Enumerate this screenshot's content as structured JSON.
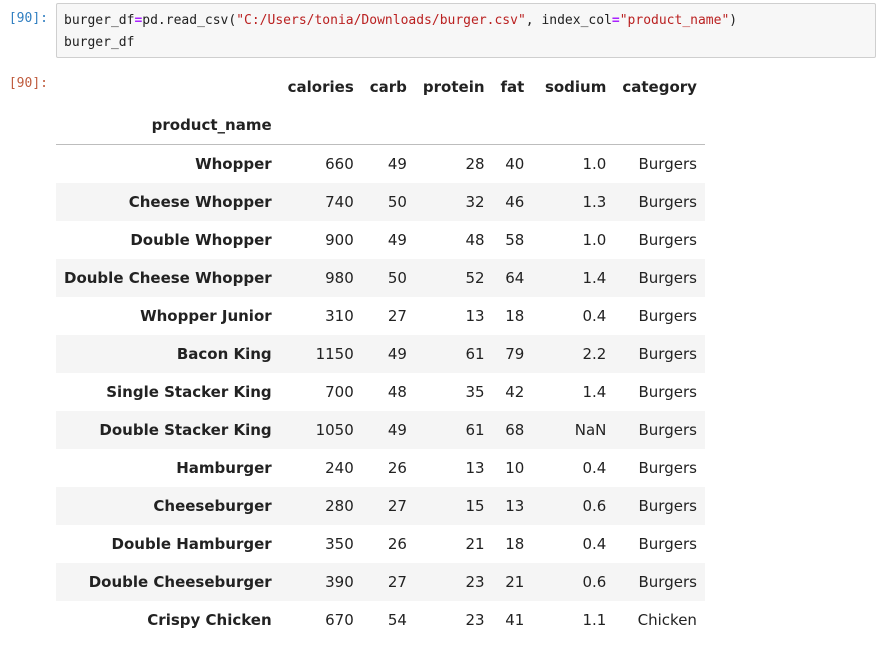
{
  "input_cell": {
    "prompt": "[90]:",
    "line1": {
      "var": "burger_df",
      "op": "=",
      "call": "pd.read_csv(",
      "path": "\"C:/Users/tonia/Downloads/burger.csv\"",
      "sep": ", index_col",
      "eq": "=",
      "arg": "\"product_name\"",
      "close": ")"
    },
    "line2": "burger_df"
  },
  "output_cell": {
    "prompt": "[90]:",
    "index_name": "product_name",
    "columns": [
      "calories",
      "carb",
      "protein",
      "fat",
      "sodium",
      "category"
    ],
    "rows": [
      {
        "name": "Whopper",
        "calories": "660",
        "carb": "49",
        "protein": "28",
        "fat": "40",
        "sodium": "1.0",
        "category": "Burgers"
      },
      {
        "name": "Cheese Whopper",
        "calories": "740",
        "carb": "50",
        "protein": "32",
        "fat": "46",
        "sodium": "1.3",
        "category": "Burgers"
      },
      {
        "name": "Double Whopper",
        "calories": "900",
        "carb": "49",
        "protein": "48",
        "fat": "58",
        "sodium": "1.0",
        "category": "Burgers"
      },
      {
        "name": "Double Cheese Whopper",
        "calories": "980",
        "carb": "50",
        "protein": "52",
        "fat": "64",
        "sodium": "1.4",
        "category": "Burgers"
      },
      {
        "name": "Whopper Junior",
        "calories": "310",
        "carb": "27",
        "protein": "13",
        "fat": "18",
        "sodium": "0.4",
        "category": "Burgers"
      },
      {
        "name": "Bacon King",
        "calories": "1150",
        "carb": "49",
        "protein": "61",
        "fat": "79",
        "sodium": "2.2",
        "category": "Burgers"
      },
      {
        "name": "Single Stacker King",
        "calories": "700",
        "carb": "48",
        "protein": "35",
        "fat": "42",
        "sodium": "1.4",
        "category": "Burgers"
      },
      {
        "name": "Double Stacker King",
        "calories": "1050",
        "carb": "49",
        "protein": "61",
        "fat": "68",
        "sodium": "NaN",
        "category": "Burgers"
      },
      {
        "name": "Hamburger",
        "calories": "240",
        "carb": "26",
        "protein": "13",
        "fat": "10",
        "sodium": "0.4",
        "category": "Burgers"
      },
      {
        "name": "Cheeseburger",
        "calories": "280",
        "carb": "27",
        "protein": "15",
        "fat": "13",
        "sodium": "0.6",
        "category": "Burgers"
      },
      {
        "name": "Double Hamburger",
        "calories": "350",
        "carb": "26",
        "protein": "21",
        "fat": "18",
        "sodium": "0.4",
        "category": "Burgers"
      },
      {
        "name": "Double Cheeseburger",
        "calories": "390",
        "carb": "27",
        "protein": "23",
        "fat": "21",
        "sodium": "0.6",
        "category": "Burgers"
      },
      {
        "name": "Crispy Chicken",
        "calories": "670",
        "carb": "54",
        "protein": "23",
        "fat": "41",
        "sodium": "1.1",
        "category": "Chicken"
      }
    ]
  }
}
